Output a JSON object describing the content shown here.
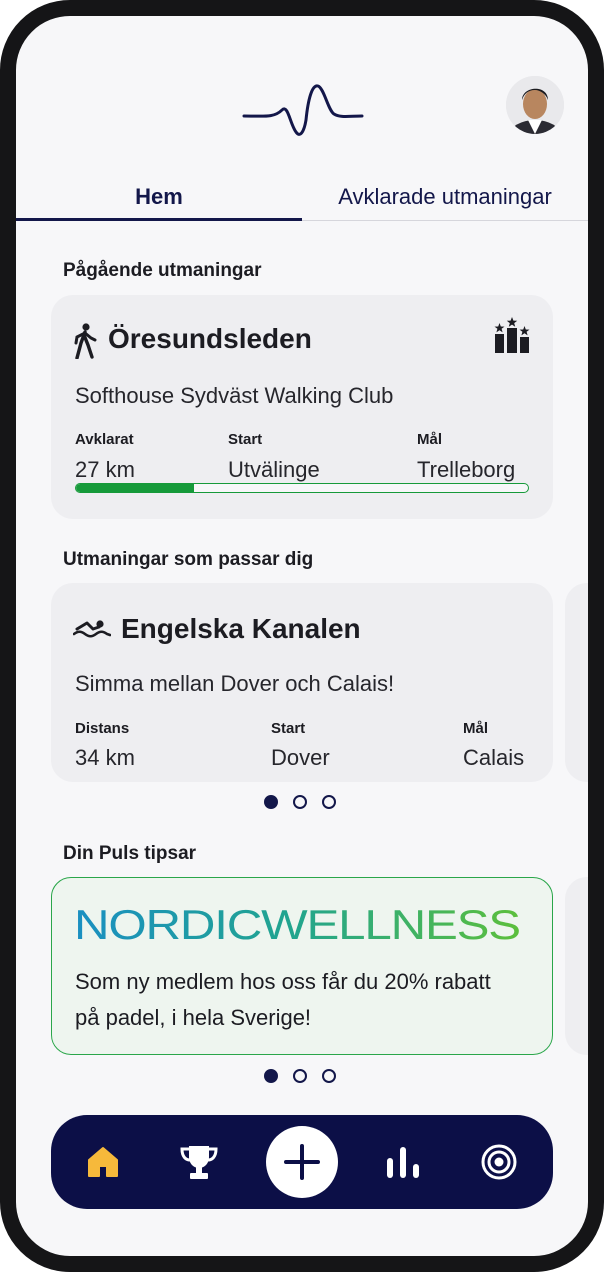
{
  "header": {
    "logo_icon": "pulse-line-icon",
    "avatar_icon": "user-avatar"
  },
  "tabs": [
    {
      "label": "Hem",
      "active": true
    },
    {
      "label": "Avklarade utmaningar",
      "active": false
    }
  ],
  "ongoing": {
    "title": "Pågående utmaningar",
    "card": {
      "icon": "walking-person-icon",
      "name": "Öresundsleden",
      "subtitle": "Softhouse Sydväst Walking Club",
      "leaderboard_icon": "podium-stars-icon",
      "completed_label": "Avklarat",
      "completed_value": "27 km",
      "start_label": "Start",
      "start_value": "Utvälinge",
      "goal_label": "Mål",
      "goal_value": "Trelleborg",
      "progress_fraction": 0.26
    }
  },
  "suggested": {
    "title": "Utmaningar som passar dig",
    "card": {
      "icon": "swimmer-icon",
      "name": "Engelska Kanalen",
      "subtitle": "Simma mellan Dover och Calais!",
      "distance_label": "Distans",
      "distance_value": "34 km",
      "start_label": "Start",
      "start_value": "Dover",
      "goal_label": "Mål",
      "goal_value": "Calais"
    },
    "pager": {
      "count": 3,
      "active": 0
    }
  },
  "tips": {
    "title": "Din Puls tipsar",
    "card": {
      "logo_text_1": "NORDIC",
      "logo_text_2": "WELLNESS",
      "text": "Som ny medlem hos oss får du 20% rabatt på padel, i hela Sverige!"
    },
    "pager": {
      "count": 3,
      "active": 0
    }
  },
  "navbar": {
    "items": [
      "home-icon",
      "trophy-icon",
      "plus-icon",
      "bar-chart-icon",
      "target-icon"
    ],
    "active": "home-icon"
  },
  "colors": {
    "primary": "#0c0f47",
    "accent_green": "#169a3a",
    "home_active": "#f6b93b",
    "card_bg": "#eeeef1"
  }
}
